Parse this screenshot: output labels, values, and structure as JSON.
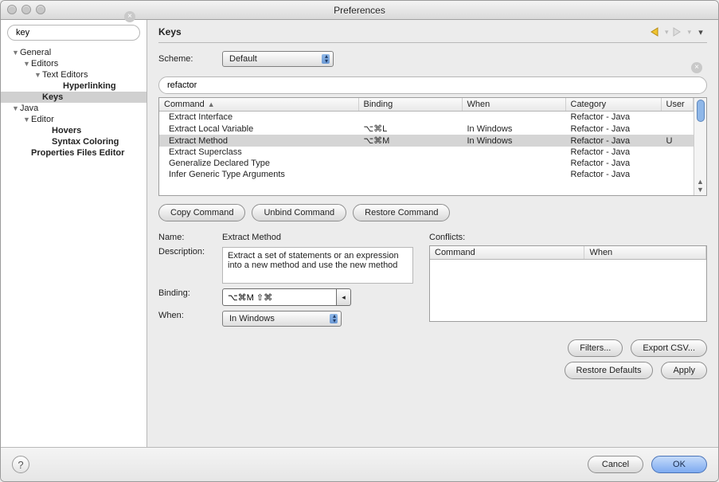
{
  "window_title": "Preferences",
  "sidebar": {
    "search_value": "key",
    "items": [
      {
        "label": "General",
        "indent": 14,
        "disc": true,
        "bold": false,
        "sel": false
      },
      {
        "label": "Editors",
        "indent": 28,
        "disc": true,
        "bold": false,
        "sel": false
      },
      {
        "label": "Text Editors",
        "indent": 42,
        "disc": true,
        "bold": false,
        "sel": false
      },
      {
        "label": "Hyperlinking",
        "indent": 68,
        "disc": false,
        "bold": true,
        "sel": false
      },
      {
        "label": "Keys",
        "indent": 42,
        "disc": false,
        "bold": true,
        "sel": true
      },
      {
        "label": "Java",
        "indent": 14,
        "disc": true,
        "bold": false,
        "sel": false
      },
      {
        "label": "Editor",
        "indent": 28,
        "disc": true,
        "bold": false,
        "sel": false
      },
      {
        "label": "Hovers",
        "indent": 54,
        "disc": false,
        "bold": true,
        "sel": false
      },
      {
        "label": "Syntax Coloring",
        "indent": 54,
        "disc": false,
        "bold": true,
        "sel": false
      },
      {
        "label": "Properties Files Editor",
        "indent": 28,
        "disc": false,
        "bold": true,
        "sel": false
      }
    ]
  },
  "page_title": "Keys",
  "scheme": {
    "label": "Scheme:",
    "value": "Default"
  },
  "filter_value": "refactor",
  "columns": {
    "c0": "Command",
    "c1": "Binding",
    "c2": "When",
    "c3": "Category",
    "c4": "User"
  },
  "rows": [
    {
      "c0": "Extract Interface",
      "c1": "",
      "c2": "",
      "c3": "Refactor - Java",
      "c4": "",
      "sel": false
    },
    {
      "c0": "Extract Local Variable",
      "c1": "⌥⌘L",
      "c2": "In Windows",
      "c3": "Refactor - Java",
      "c4": "",
      "sel": false
    },
    {
      "c0": "Extract Method",
      "c1": "⌥⌘M",
      "c2": "In Windows",
      "c3": "Refactor - Java",
      "c4": "U",
      "sel": true
    },
    {
      "c0": "Extract Superclass",
      "c1": "",
      "c2": "",
      "c3": "Refactor - Java",
      "c4": "",
      "sel": false
    },
    {
      "c0": "Generalize Declared Type",
      "c1": "",
      "c2": "",
      "c3": "Refactor - Java",
      "c4": "",
      "sel": false
    },
    {
      "c0": "Infer Generic Type Arguments",
      "c1": "",
      "c2": "",
      "c3": "Refactor - Java",
      "c4": "",
      "sel": false
    }
  ],
  "btns": {
    "copy": "Copy Command",
    "unbind": "Unbind Command",
    "restore": "Restore Command"
  },
  "detail": {
    "name_lbl": "Name:",
    "name": "Extract Method",
    "desc_lbl": "Description:",
    "desc": "Extract a set of statements or an expression into a new method and use the new method",
    "bind_lbl": "Binding:",
    "bind": "⌥⌘M ⇧⌘",
    "when_lbl": "When:",
    "when": "In Windows"
  },
  "conflicts": {
    "title": "Conflicts:",
    "col0": "Command",
    "col1": "When"
  },
  "right": {
    "filters": "Filters...",
    "export": "Export CSV...",
    "defaults": "Restore Defaults",
    "apply": "Apply"
  },
  "footer": {
    "cancel": "Cancel",
    "ok": "OK"
  }
}
